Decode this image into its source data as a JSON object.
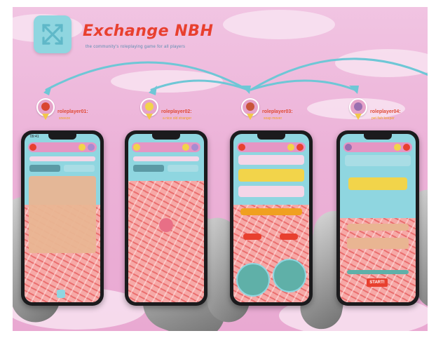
{
  "header": {
    "title": "Exchange NBH",
    "subtitle": "the community's roleplaying game for all players"
  },
  "players": [
    {
      "name": "roleplayer01:",
      "sub": "sneeze"
    },
    {
      "name": "roleplayer02:",
      "sub": "a nice old stranger"
    },
    {
      "name": "roleplayer03:",
      "sub": "soap mover"
    },
    {
      "name": "roleplayer04:",
      "sub": "pet fish keeper"
    }
  ],
  "phones": {
    "start_label": "START!",
    "status_time": "09:41"
  },
  "colors": {
    "accent": "#e8402f",
    "screen_bg": "#8fd6e0",
    "map_base": "#f08585",
    "background": "#ecb2d8"
  }
}
